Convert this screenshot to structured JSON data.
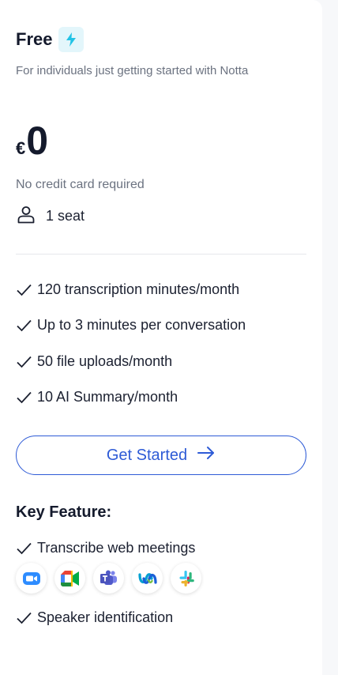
{
  "plan": {
    "name": "Free",
    "subtitle": "For individuals just getting started with Notta",
    "currency": "€",
    "price": "0",
    "no_card": "No credit card required",
    "seats": "1 seat"
  },
  "features": [
    "120 transcription minutes/month",
    "Up to 3 minutes per conversation",
    "50 file uploads/month",
    "10 AI Summary/month"
  ],
  "cta": {
    "label": "Get Started"
  },
  "key_feature": {
    "title": "Key Feature:",
    "items": [
      "Transcribe web meetings",
      "Speaker identification"
    ],
    "integrations": [
      "zoom-icon",
      "google-meet-icon",
      "microsoft-teams-icon",
      "webex-icon",
      "slack-icon"
    ]
  },
  "colors": {
    "accent": "#2e5bd6",
    "bolt": "#22c3e6",
    "bolt_bg": "#e3f6fb",
    "text_primary": "#141a2c",
    "text_muted": "#6b7280"
  }
}
